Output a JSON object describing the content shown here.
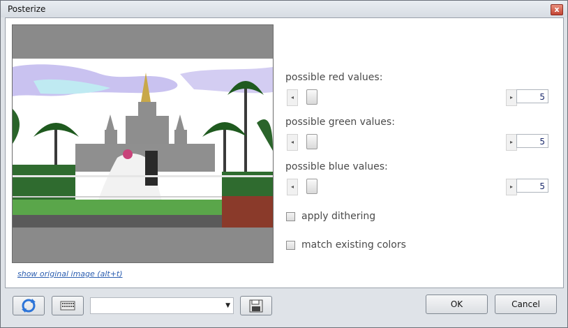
{
  "window": {
    "title": "Posterize",
    "close_glyph": "x"
  },
  "preview": {
    "image": "posterized wedding photo in front of temple"
  },
  "show_original_link": "show original image (alt+t)",
  "controls": {
    "red": {
      "label": "possible red values:",
      "value": "5"
    },
    "green": {
      "label": "possible green values:",
      "value": "5"
    },
    "blue": {
      "label": "possible blue values:",
      "value": "5"
    },
    "dithering": {
      "label": "apply dithering",
      "checked": false
    },
    "match": {
      "label": "match existing colors",
      "checked": false
    }
  },
  "footer": {
    "ok_label": "OK",
    "cancel_label": "Cancel",
    "preset_value": ""
  },
  "colors": {
    "accent": "#2a5db0",
    "value_text": "#1b2a6c"
  }
}
